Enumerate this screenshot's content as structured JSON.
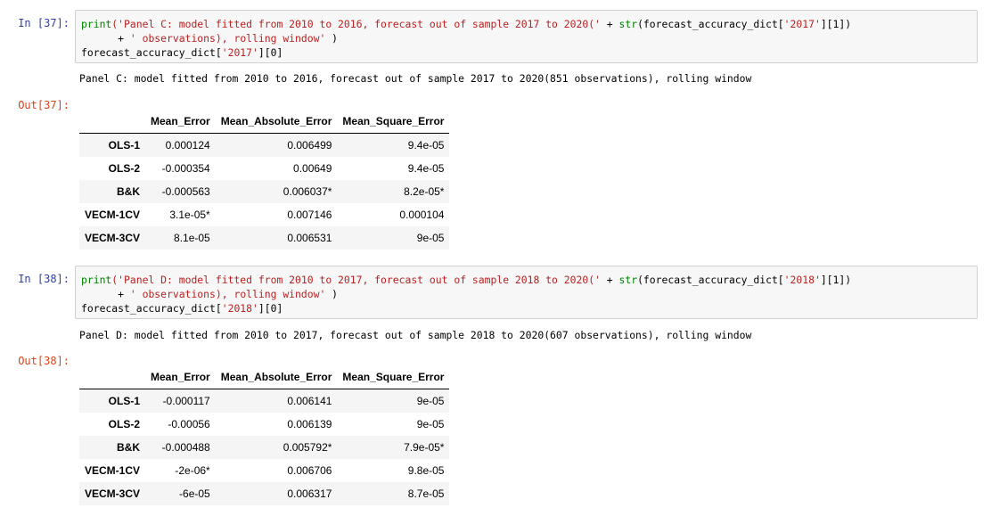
{
  "cells": [
    {
      "in_prompt": "In  [37]:",
      "out_prompt": "Out[37]:",
      "code": {
        "l1_a": "print",
        "l1_b": "('Panel C: model fitted from 2010 to 2016, forecast out of sample 2017 to 2020(' ",
        "l1_c": "+",
        "l1_d": " ",
        "l1_e": "str",
        "l1_f": "(forecast_accuracy_dict[",
        "l1_g": "'2017'",
        "l1_h": "][1])",
        "l2_a": "      ",
        "l2_b": "+",
        "l2_c": " ",
        "l2_d": "' observations), rolling window'",
        "l2_e": " )",
        "l3_a": "forecast_accuracy_dict[",
        "l3_b": "'2017'",
        "l3_c": "][0]"
      },
      "stdout": "Panel C: model fitted from 2010 to 2016, forecast out of sample 2017 to 2020(851 observations), rolling window",
      "table": {
        "columns": [
          "",
          "Mean_Error",
          "Mean_Absolute_Error",
          "Mean_Square_Error"
        ],
        "rows": [
          [
            "OLS-1",
            "0.000124",
            "0.006499",
            "9.4e-05"
          ],
          [
            "OLS-2",
            "-0.000354",
            "0.00649",
            "9.4e-05"
          ],
          [
            "B&K",
            "-0.000563",
            "0.006037*",
            "8.2e-05*"
          ],
          [
            "VECM-1CV",
            "3.1e-05*",
            "0.007146",
            "0.000104"
          ],
          [
            "VECM-3CV",
            "8.1e-05",
            "0.006531",
            "9e-05"
          ]
        ]
      }
    },
    {
      "in_prompt": "In  [38]:",
      "out_prompt": "Out[38]:",
      "code": {
        "l1_a": "print",
        "l1_b": "('Panel D: model fitted from 2010 to 2017, forecast out of sample 2018 to 2020(' ",
        "l1_c": "+",
        "l1_d": " ",
        "l1_e": "str",
        "l1_f": "(forecast_accuracy_dict[",
        "l1_g": "'2018'",
        "l1_h": "][1])",
        "l2_a": "      ",
        "l2_b": "+",
        "l2_c": " ",
        "l2_d": "' observations), rolling window'",
        "l2_e": " )",
        "l3_a": "forecast_accuracy_dict[",
        "l3_b": "'2018'",
        "l3_c": "][0]"
      },
      "stdout": "Panel D: model fitted from 2010 to 2017, forecast out of sample 2018 to 2020(607 observations), rolling window",
      "table": {
        "columns": [
          "",
          "Mean_Error",
          "Mean_Absolute_Error",
          "Mean_Square_Error"
        ],
        "rows": [
          [
            "OLS-1",
            "-0.000117",
            "0.006141",
            "9e-05"
          ],
          [
            "OLS-2",
            "-0.00056",
            "0.006139",
            "9e-05"
          ],
          [
            "B&K",
            "-0.000488",
            "0.005792*",
            "7.9e-05*"
          ],
          [
            "VECM-1CV",
            "-2e-06*",
            "0.006706",
            "9.8e-05"
          ],
          [
            "VECM-3CV",
            "-6e-05",
            "0.006317",
            "8.7e-05"
          ]
        ]
      }
    }
  ],
  "colors": {
    "in_prompt": "#303f9f",
    "out_prompt": "#d84315",
    "keyword": "#008000",
    "string": "#ba2121"
  }
}
